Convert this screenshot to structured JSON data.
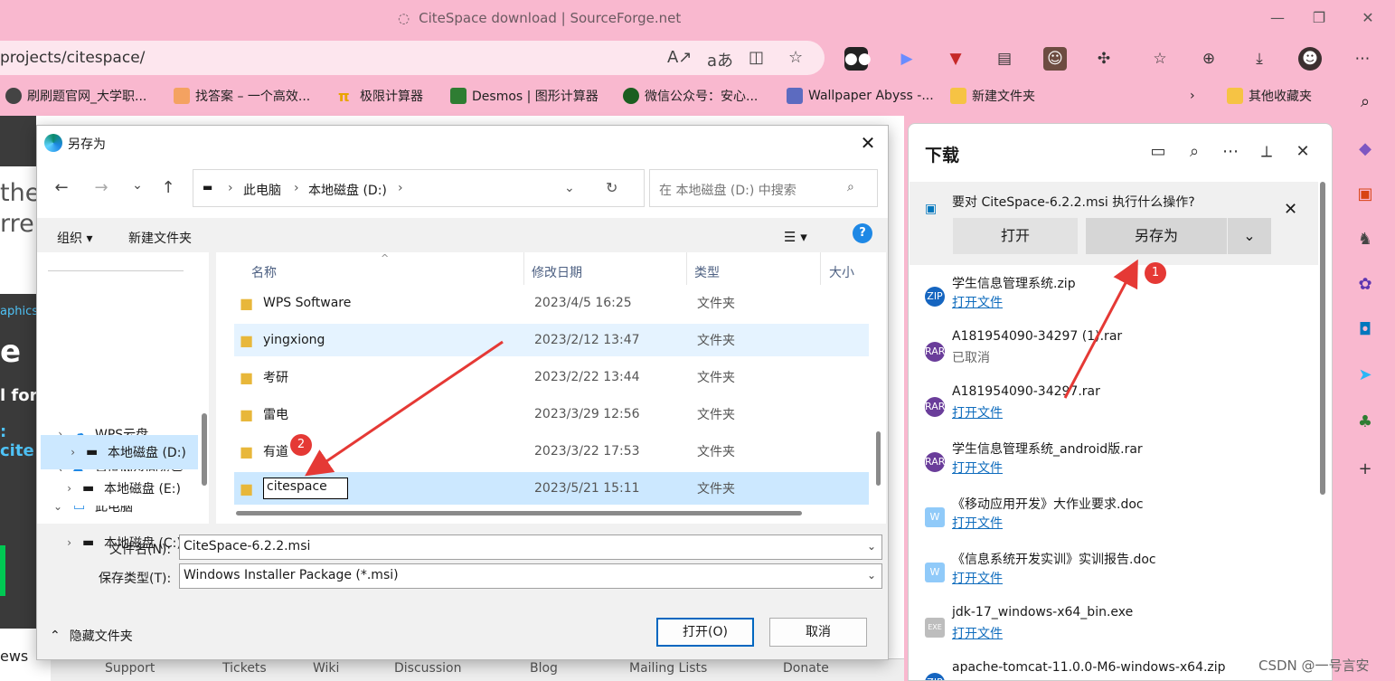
{
  "browser": {
    "window_title": "CiteSpace download | SourceForge.net",
    "url": "projects/citespace/",
    "bookmarks": [
      {
        "label": "刷刷题官网_大学职..."
      },
      {
        "label": "找答案 – 一个高效..."
      },
      {
        "label": "极限计算器"
      },
      {
        "label": "Desmos | 图形计算器"
      },
      {
        "label": "微信公众号：安心..."
      },
      {
        "label": "Wallpaper Abyss -..."
      },
      {
        "label": "新建文件夹"
      },
      {
        "label": "其他收藏夹"
      }
    ]
  },
  "webpage": {
    "frag1": "the",
    "frag2": "rre",
    "frag3": "aphics",
    "frag4": "e",
    "frag5": "l for",
    "frag6": ": cite",
    "frag7": "ews",
    "footer_tabs": [
      "Support",
      "Tickets",
      "Wiki",
      "Discussion",
      "Blog",
      "Mailing Lists",
      "Donate"
    ]
  },
  "dialog": {
    "title": "另存为",
    "path": [
      "此电脑",
      "本地磁盘 (D:)"
    ],
    "search_placeholder": "在 本地磁盘 (D:) 中搜索",
    "organize": "组织 ▾",
    "new_folder": "新建文件夹",
    "tree": [
      {
        "label": "WPS云盘"
      },
      {
        "label": "百度网盘同步空"
      },
      {
        "label": "此电脑"
      },
      {
        "label": "本地磁盘 (C:)"
      },
      {
        "label": "本地磁盘 (D:)"
      },
      {
        "label": "本地磁盘 (E:)"
      }
    ],
    "columns": {
      "name": "名称",
      "date": "修改日期",
      "type": "类型",
      "size": "大小"
    },
    "files": [
      {
        "name": "WPS Software",
        "date": "2023/4/5 16:25",
        "type": "文件夹"
      },
      {
        "name": "yingxiong",
        "date": "2023/2/12 13:47",
        "type": "文件夹"
      },
      {
        "name": "考研",
        "date": "2023/2/22 13:44",
        "type": "文件夹"
      },
      {
        "name": "雷电",
        "date": "2023/3/29 12:56",
        "type": "文件夹"
      },
      {
        "name": "有道",
        "date": "2023/3/22 17:53",
        "type": "文件夹"
      },
      {
        "name": "citespace",
        "date": "2023/5/21 15:11",
        "type": "文件夹"
      }
    ],
    "filename_label": "文件名(N):",
    "filename_value": "CiteSpace-6.2.2.msi",
    "filetype_label": "保存类型(T):",
    "filetype_value": "Windows Installer Package (*.msi)",
    "hide_folders": "隐藏文件夹",
    "open_button": "打开(O)",
    "cancel_button": "取消"
  },
  "downloads": {
    "title": "下载",
    "prompt": "要对 CiteSpace-6.2.2.msi 执行什么操作?",
    "open": "打开",
    "save_as": "另存为",
    "items": [
      {
        "name": "学生信息管理系统.zip",
        "action": "打开文件",
        "color": "#1565c0",
        "tag": "ZIP"
      },
      {
        "name": "A181954090-34297 (1).rar",
        "action": "已取消",
        "color": "#6a3d9a",
        "tag": "RAR"
      },
      {
        "name": "A181954090-34297.rar",
        "action": "打开文件",
        "color": "#6a3d9a",
        "tag": "RAR"
      },
      {
        "name": "学生信息管理系统_android版.rar",
        "action": "打开文件",
        "color": "#6a3d9a",
        "tag": "RAR"
      },
      {
        "name": "《移动应用开发》大作业要求.doc",
        "action": "打开文件",
        "color": "#90caf9",
        "tag": "W"
      },
      {
        "name": "《信息系统开发实训》实训报告.doc",
        "action": "打开文件",
        "color": "#90caf9",
        "tag": "W"
      },
      {
        "name": "jdk-17_windows-x64_bin.exe",
        "action": "打开文件",
        "color": "#bdbdbd",
        "tag": "EXE"
      },
      {
        "name": "apache-tomcat-11.0.0-M6-windows-x64.zip",
        "action": "",
        "color": "#1565c0",
        "tag": "ZIP"
      }
    ]
  },
  "annotations": {
    "badge1": "1",
    "badge2": "2"
  },
  "watermark": "CSDN @一号言安"
}
